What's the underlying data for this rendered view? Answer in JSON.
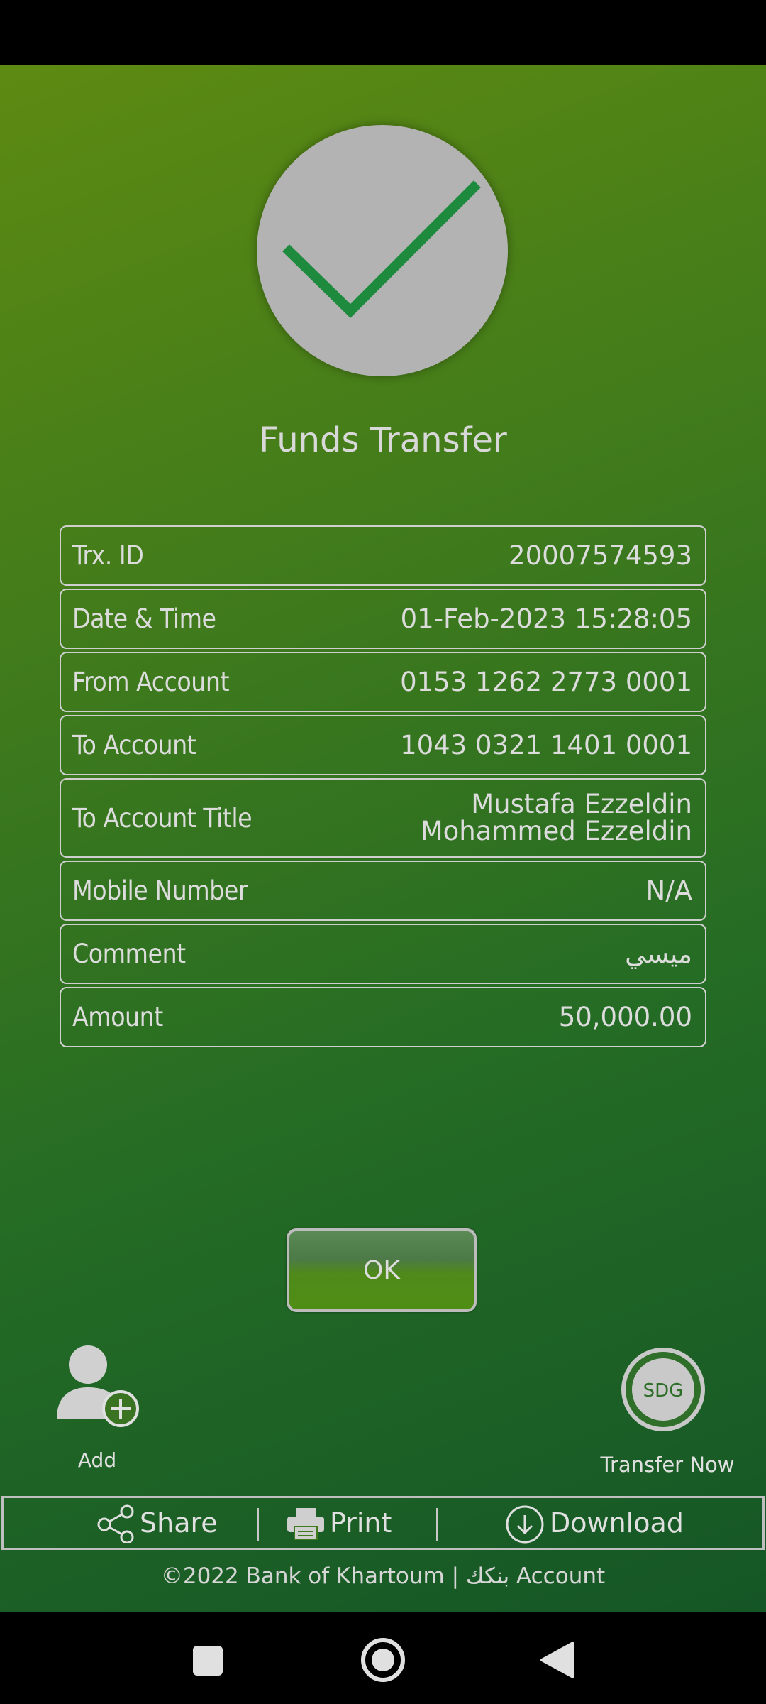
{
  "screen_title": "Funds Transfer",
  "details": [
    {
      "label": "Trx. ID",
      "value": "20007574593"
    },
    {
      "label": "Date & Time",
      "value": "01-Feb-2023 15:28:05"
    },
    {
      "label": "From Account",
      "value": "0153 1262 2773 0001"
    },
    {
      "label": "To Account",
      "value": "1043 0321 1401 0001"
    },
    {
      "label": "To Account Title",
      "value": "Mustafa Ezzeldin\nMohammed Ezzeldin"
    },
    {
      "label": "Mobile Number",
      "value": "N/A"
    },
    {
      "label": "Comment",
      "value": "ميسي"
    },
    {
      "label": "Amount",
      "value": "50,000.00"
    }
  ],
  "ok_label": "OK",
  "shortcuts": {
    "add_label": "Add",
    "transfer_label": "Transfer Now",
    "transfer_badge": "SDG"
  },
  "actions": {
    "share_label": "Share",
    "print_label": "Print",
    "download_label": "Download"
  },
  "footer": "©2022 Bank of Khartoum | بنكك Account",
  "colors": {
    "background_top": "#5d8a12",
    "background_bottom": "#155626",
    "check": "#1d8a3e",
    "circle": "#b3b3b3"
  },
  "icons": {
    "success": "checkmark-icon",
    "add": "add-user-icon",
    "share": "share-icon",
    "print": "printer-icon",
    "download": "download-icon",
    "nav_recents": "square-icon",
    "nav_home": "circle-icon",
    "nav_back": "triangle-back-icon"
  }
}
